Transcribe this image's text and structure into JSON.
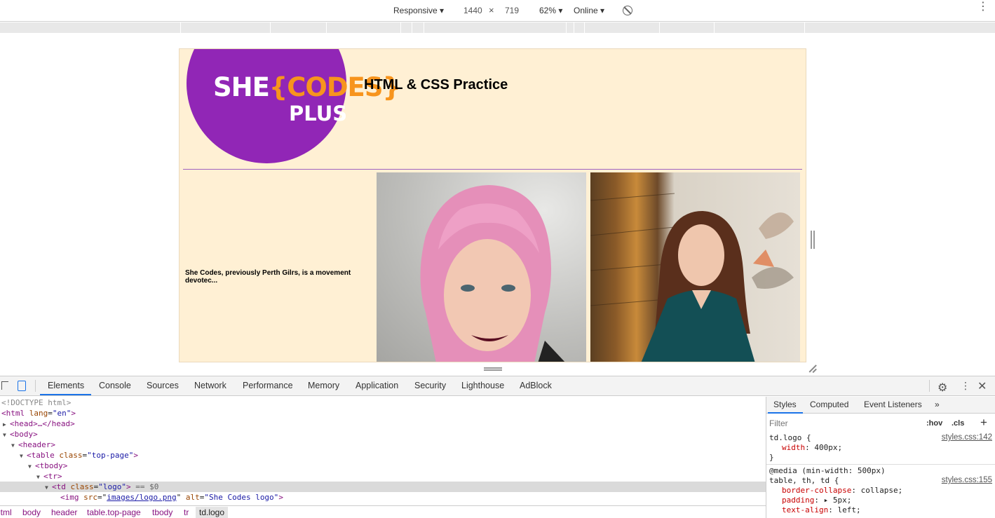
{
  "device_toolbar": {
    "device": "Responsive",
    "width": "1440",
    "times": "×",
    "height": "719",
    "zoom": "62%",
    "network": "Online"
  },
  "page": {
    "logo_she": "SHE",
    "logo_codes": "{CODES}",
    "logo_plus": "PLUS",
    "heading": "HTML & CSS Practice",
    "bio": "She Codes, previously Perth Gilrs, is a movement devotec..."
  },
  "devtools": {
    "tabs": [
      "Elements",
      "Console",
      "Sources",
      "Network",
      "Performance",
      "Memory",
      "Application",
      "Security",
      "Lighthouse",
      "AdBlock"
    ],
    "dom_lines": {
      "doctype": "<!DOCTYPE html>",
      "html_open": "<html",
      "html_attr": "lang",
      "html_val": "\"en\"",
      "head": "<head>…</head>",
      "body": "<body>",
      "header": "<header>",
      "table_tag": "<table",
      "table_attr": "class",
      "table_val": "\"top-page\"",
      "tbody": "<tbody>",
      "tr": "<tr>",
      "td_tag": "<td",
      "td_attr": "class",
      "td_val": "\"logo\"",
      "td_suffix": "== $0",
      "img_tag": "<img",
      "img_src_attr": "src",
      "img_src": "images/logo.png",
      "img_alt_attr": "alt",
      "img_alt": "\"She Codes logo\""
    },
    "breadcrumbs": [
      "html",
      "body",
      "header",
      "table.top-page",
      "tbody",
      "tr",
      "td.logo"
    ],
    "styles": {
      "tabs": [
        "Styles",
        "Computed",
        "Event Listeners",
        "»"
      ],
      "filter_placeholder": "Filter",
      "hov": ":hov",
      "cls": ".cls",
      "rule1_selector": "td.logo {",
      "rule1_source": "styles.css:142",
      "rule1_prop": "width",
      "rule1_value": "400px;",
      "rule1_close": "}",
      "rule2_media": "@media (min-width: 500px)",
      "rule2_selector": "table, th, td {",
      "rule2_source": "styles.css:155",
      "rule2_props": [
        {
          "prop": "border-collapse",
          "value": "collapse;"
        },
        {
          "prop": "padding",
          "value": "▸ 5px;"
        },
        {
          "prop": "text-align",
          "value": "left;"
        }
      ]
    }
  },
  "colors": {
    "page_bg": "#fff0d4",
    "logo_purple": "#9126b6",
    "logo_orange": "#f7941d",
    "devtools_active": "#1a73e8"
  }
}
